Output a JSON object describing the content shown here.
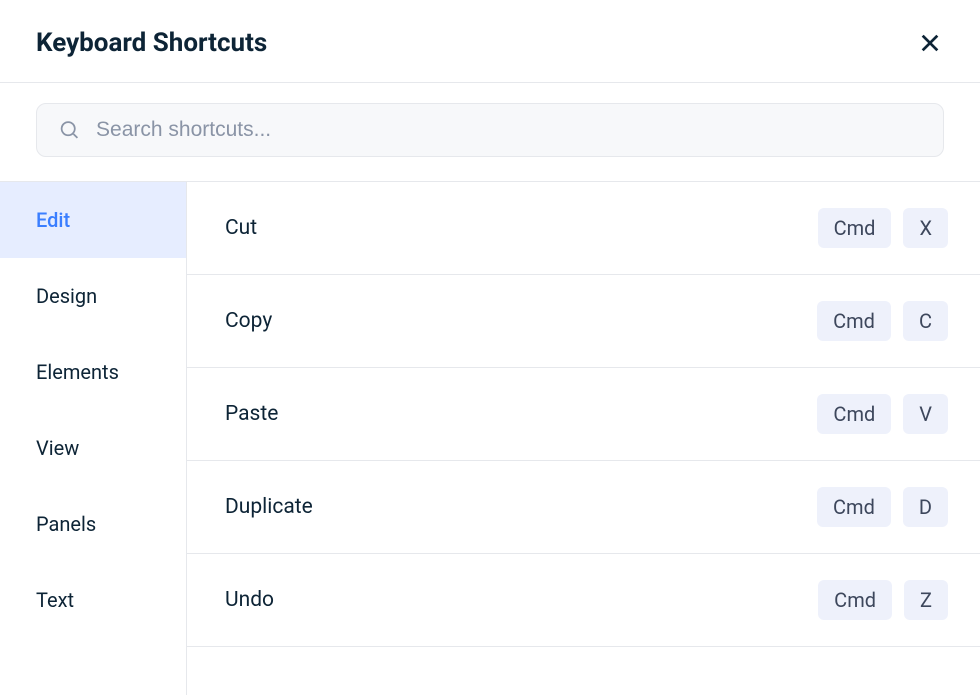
{
  "header": {
    "title": "Keyboard Shortcuts"
  },
  "search": {
    "placeholder": "Search shortcuts..."
  },
  "sidebar": {
    "items": [
      {
        "label": "Edit",
        "active": true
      },
      {
        "label": "Design",
        "active": false
      },
      {
        "label": "Elements",
        "active": false
      },
      {
        "label": "View",
        "active": false
      },
      {
        "label": "Panels",
        "active": false
      },
      {
        "label": "Text",
        "active": false
      }
    ]
  },
  "shortcuts": [
    {
      "label": "Cut",
      "keys": [
        "Cmd",
        "X"
      ]
    },
    {
      "label": "Copy",
      "keys": [
        "Cmd",
        "C"
      ]
    },
    {
      "label": "Paste",
      "keys": [
        "Cmd",
        "V"
      ]
    },
    {
      "label": "Duplicate",
      "keys": [
        "Cmd",
        "D"
      ]
    },
    {
      "label": "Undo",
      "keys": [
        "Cmd",
        "Z"
      ]
    }
  ]
}
